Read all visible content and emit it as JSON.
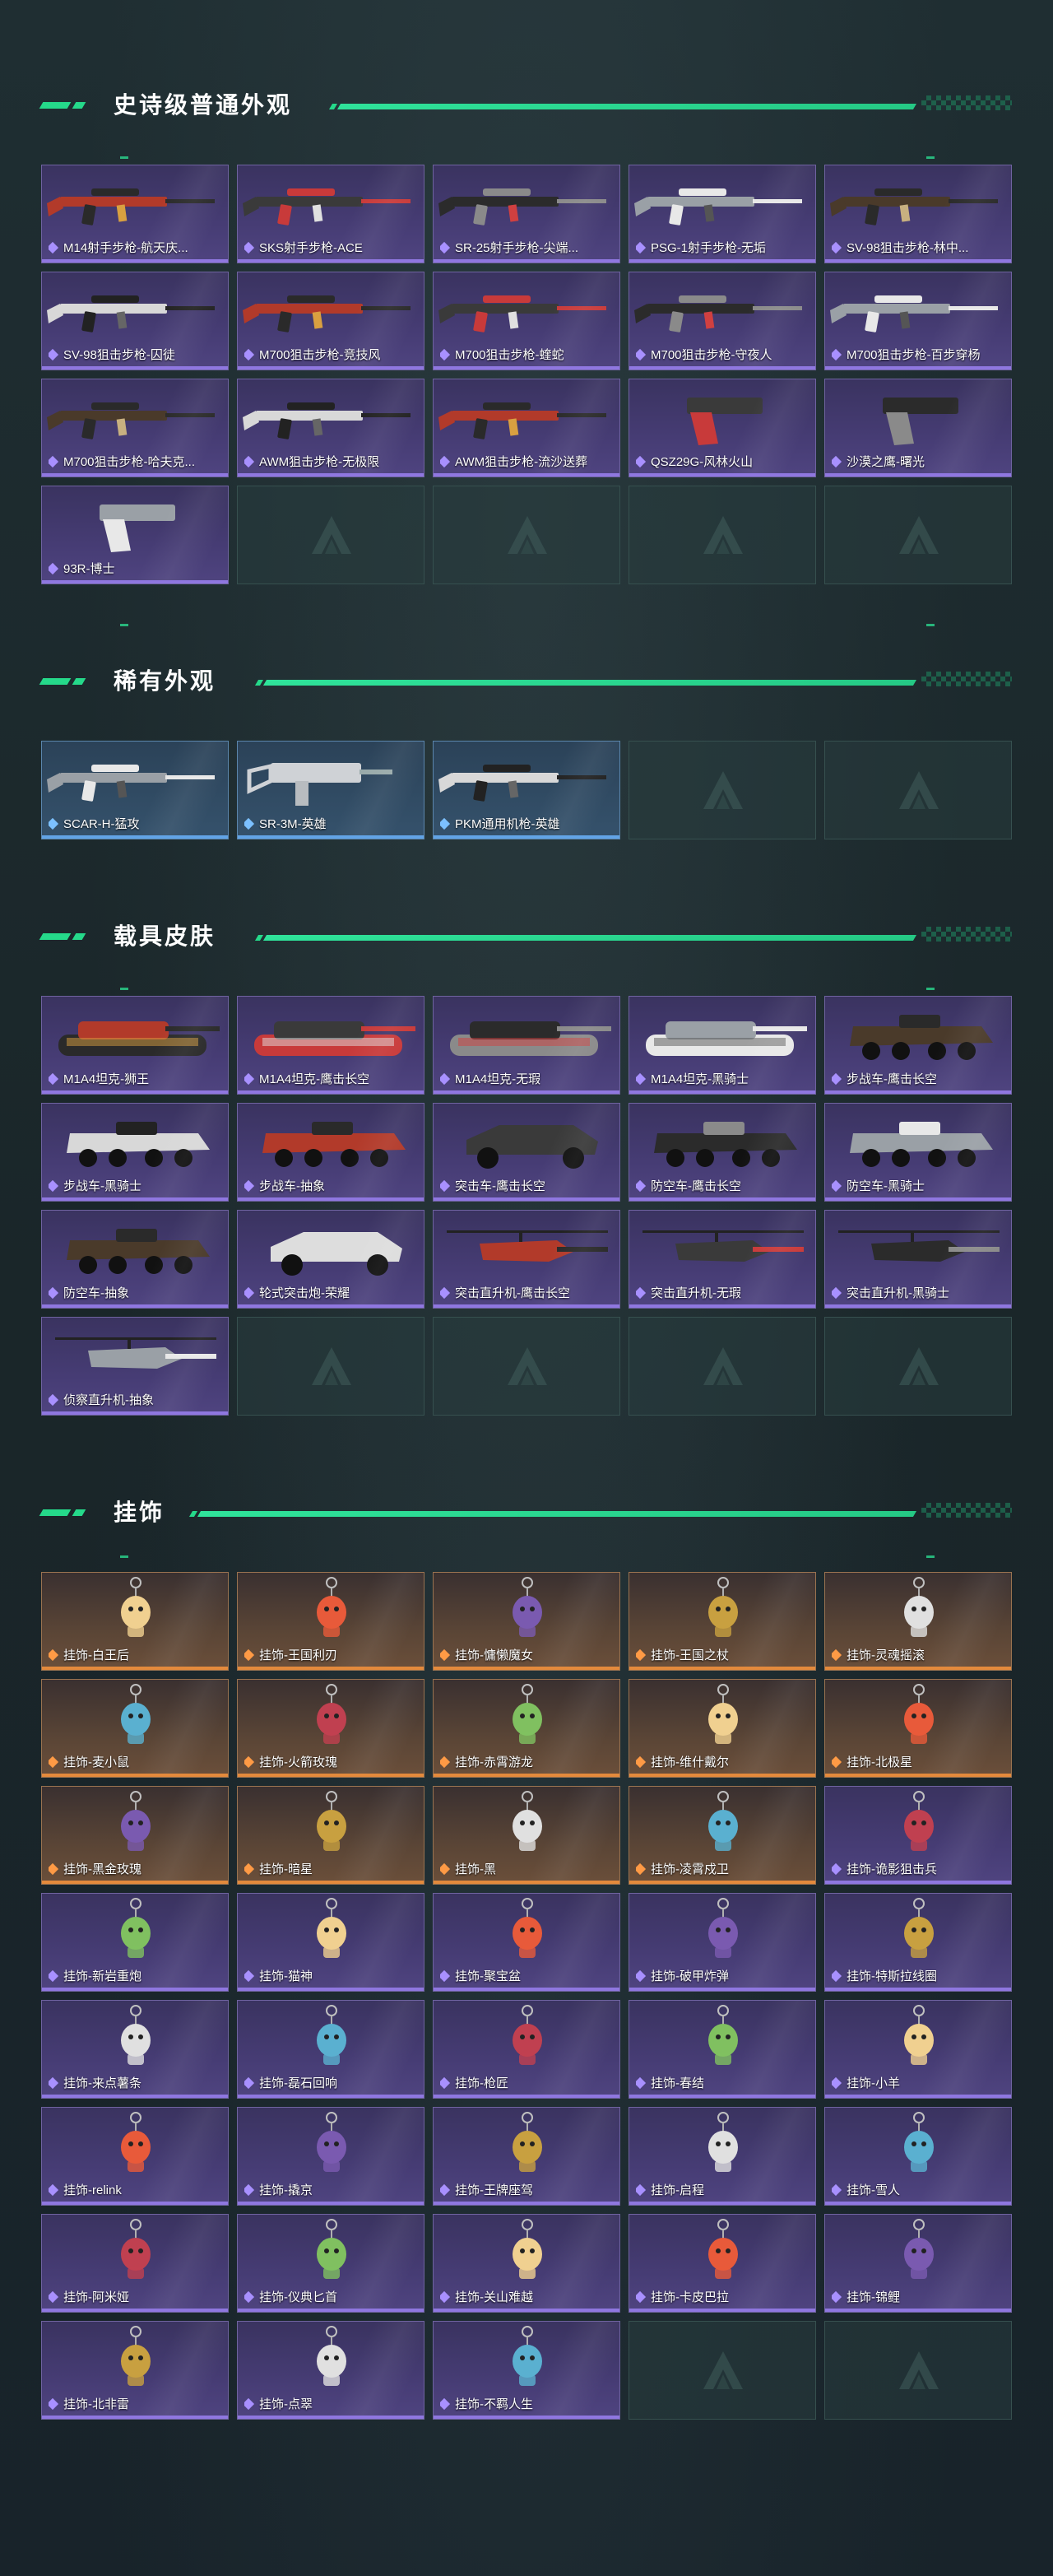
{
  "sections": [
    {
      "title": "史诗级普通外观",
      "items": [
        {
          "label": "M14射手步枪-航天庆...",
          "kind": "gun"
        },
        {
          "label": "SKS射手步枪-ACE",
          "kind": "gun"
        },
        {
          "label": "SR-25射手步枪-尖端...",
          "kind": "gun"
        },
        {
          "label": "PSG-1射手步枪-无垢",
          "kind": "gun"
        },
        {
          "label": "SV-98狙击步枪-林中...",
          "kind": "gun"
        },
        {
          "label": "SV-98狙击步枪-囚徒",
          "kind": "gun"
        },
        {
          "label": "M700狙击步枪-竞技风",
          "kind": "gun"
        },
        {
          "label": "M700狙击步枪-蝰蛇",
          "kind": "gun"
        },
        {
          "label": "M700狙击步枪-守夜人",
          "kind": "gun"
        },
        {
          "label": "M700狙击步枪-百步穿杨",
          "kind": "gun"
        },
        {
          "label": "M700狙击步枪-哈夫克...",
          "kind": "gun"
        },
        {
          "label": "AWM狙击步枪-无极限",
          "kind": "gun"
        },
        {
          "label": "AWM狙击步枪-流沙送葬",
          "kind": "gun"
        },
        {
          "label": "QSZ29G-风林火山",
          "kind": "pistol"
        },
        {
          "label": "沙漠之鹰-曙光",
          "kind": "pistol"
        },
        {
          "label": "93R-博士",
          "kind": "pistol"
        }
      ],
      "empty_slots": 4
    },
    {
      "title": "稀有外观",
      "items": [
        {
          "label": "SCAR-H-猛攻",
          "kind": "gun"
        },
        {
          "label": "SR-3M-英雄",
          "kind": "smg"
        },
        {
          "label": "PKM通用机枪-英雄",
          "kind": "gun"
        }
      ],
      "empty_slots": 2
    },
    {
      "title": "载具皮肤",
      "items": [
        {
          "label": "M1A4坦克-狮王",
          "kind": "tank"
        },
        {
          "label": "M1A4坦克-鹰击长空",
          "kind": "tank"
        },
        {
          "label": "M1A4坦克-无瑕",
          "kind": "tank"
        },
        {
          "label": "M1A4坦克-黑骑士",
          "kind": "tank"
        },
        {
          "label": "步战车-鹰击长空",
          "kind": "apc"
        },
        {
          "label": "步战车-黑骑士",
          "kind": "apc"
        },
        {
          "label": "步战车-抽象",
          "kind": "apc"
        },
        {
          "label": "突击车-鹰击长空",
          "kind": "buggy"
        },
        {
          "label": "防空车-鹰击长空",
          "kind": "apc"
        },
        {
          "label": "防空车-黑骑士",
          "kind": "apc"
        },
        {
          "label": "防空车-抽象",
          "kind": "apc"
        },
        {
          "label": "轮式突击炮-荣耀",
          "kind": "buggy"
        },
        {
          "label": "突击直升机-鹰击长空",
          "kind": "heli"
        },
        {
          "label": "突击直升机-无瑕",
          "kind": "heli"
        },
        {
          "label": "突击直升机-黑骑士",
          "kind": "heli"
        },
        {
          "label": "侦察直升机-抽象",
          "kind": "heli"
        }
      ],
      "empty_slots": 4
    },
    {
      "title": "挂饰",
      "items": [
        {
          "label": "挂饰-白王后",
          "tier": "legend"
        },
        {
          "label": "挂饰-王国利刃",
          "tier": "legend"
        },
        {
          "label": "挂饰-慵懒魔女",
          "tier": "legend"
        },
        {
          "label": "挂饰-王国之杖",
          "tier": "legend"
        },
        {
          "label": "挂饰-灵魂摇滚",
          "tier": "legend"
        },
        {
          "label": "挂饰-麦小鼠",
          "tier": "legend"
        },
        {
          "label": "挂饰-火箭玫瑰",
          "tier": "legend"
        },
        {
          "label": "挂饰-赤霄游龙",
          "tier": "legend"
        },
        {
          "label": "挂饰-维什戴尔",
          "tier": "legend"
        },
        {
          "label": "挂饰-北极星",
          "tier": "legend"
        },
        {
          "label": "挂饰-黑金玫瑰",
          "tier": "legend"
        },
        {
          "label": "挂饰-暗星",
          "tier": "legend"
        },
        {
          "label": "挂饰-黑",
          "tier": "legend"
        },
        {
          "label": "挂饰-凌霄戍卫",
          "tier": "legend"
        },
        {
          "label": "挂饰-诡影狙击兵",
          "tier": "epic"
        },
        {
          "label": "挂饰-新岩重炮",
          "tier": "epic"
        },
        {
          "label": "挂饰-猫神",
          "tier": "epic"
        },
        {
          "label": "挂饰-聚宝盆",
          "tier": "epic"
        },
        {
          "label": "挂饰-破甲炸弹",
          "tier": "epic"
        },
        {
          "label": "挂饰-特斯拉线圈",
          "tier": "epic"
        },
        {
          "label": "挂饰-来点薯条",
          "tier": "epic"
        },
        {
          "label": "挂饰-磊石回响",
          "tier": "epic"
        },
        {
          "label": "挂饰-枪匠",
          "tier": "epic"
        },
        {
          "label": "挂饰-春结",
          "tier": "epic"
        },
        {
          "label": "挂饰-小羊",
          "tier": "epic"
        },
        {
          "label": "挂饰-relink",
          "tier": "epic"
        },
        {
          "label": "挂饰-撬京",
          "tier": "epic"
        },
        {
          "label": "挂饰-王牌座驾",
          "tier": "epic"
        },
        {
          "label": "挂饰-启程",
          "tier": "epic"
        },
        {
          "label": "挂饰-雪人",
          "tier": "epic"
        },
        {
          "label": "挂饰-阿米娅",
          "tier": "epic"
        },
        {
          "label": "挂饰-仪典匕首",
          "tier": "epic"
        },
        {
          "label": "挂饰-关山难越",
          "tier": "epic"
        },
        {
          "label": "挂饰-卡皮巴拉",
          "tier": "epic"
        },
        {
          "label": "挂饰-锦鲤",
          "tier": "epic"
        },
        {
          "label": "挂饰-北非雷",
          "tier": "epic"
        },
        {
          "label": "挂饰-点翠",
          "tier": "epic"
        },
        {
          "label": "挂饰-不羁人生",
          "tier": "epic"
        }
      ],
      "empty_slots": 2
    }
  ],
  "colors": {
    "accent": "#25d98a",
    "epic": "#8f77e0",
    "rare": "#62a4e6",
    "legend": "#e48a3c"
  }
}
